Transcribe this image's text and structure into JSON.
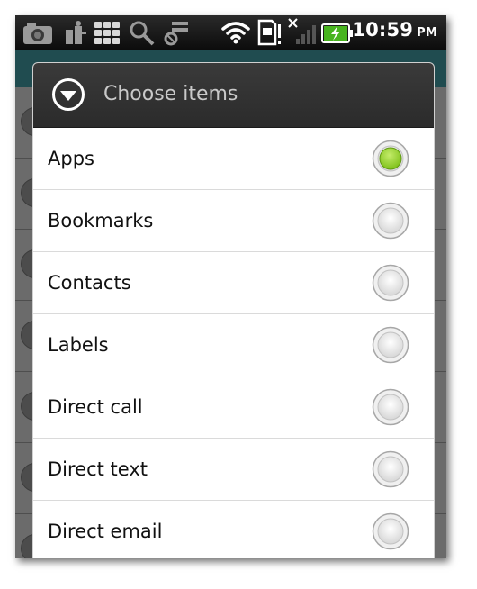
{
  "status_bar": {
    "time": "10:59",
    "ampm": "PM",
    "icons": [
      "camera-icon",
      "usb-debug-icon",
      "grid-icon",
      "search-settings-icon",
      "sd-card-icon",
      "wifi-icon",
      "sim-alert-icon",
      "no-signal-icon",
      "battery-charging-icon"
    ]
  },
  "dialog": {
    "title": "Choose items",
    "header_icon": "dropdown-arrow-circle-icon",
    "selected_index": 0,
    "items": [
      {
        "label": "Apps",
        "selected": true
      },
      {
        "label": "Bookmarks",
        "selected": false
      },
      {
        "label": "Contacts",
        "selected": false
      },
      {
        "label": "Labels",
        "selected": false
      },
      {
        "label": "Direct call",
        "selected": false
      },
      {
        "label": "Direct text",
        "selected": false
      },
      {
        "label": "Direct email",
        "selected": false
      }
    ]
  },
  "colors": {
    "radio_selected": "#7fc11a",
    "header_bg": "#333333",
    "toolbar_bg": "#3b8a92"
  }
}
